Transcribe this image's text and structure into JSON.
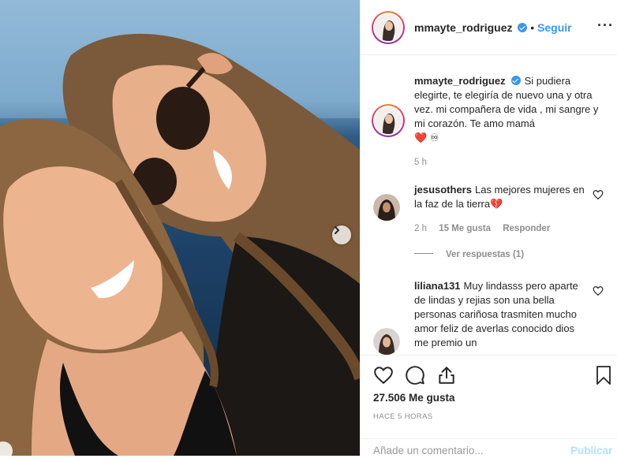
{
  "photo": {
    "description_icon": "next-arrow-icon"
  },
  "header": {
    "username": "mmayte_rodriguez",
    "follow_label": "Seguir",
    "more_icon": "more-options-icon"
  },
  "caption": {
    "username": "mmayte_rodriguez",
    "text": "Si pudiera elegirte, te elegiría de nuevo una y otra vez. mi compañera de vida , mi sangre y mi corazón. Te amo mamá",
    "emoji": "❤️ ♾",
    "time": "5 h"
  },
  "comments": [
    {
      "username": "jesusothers",
      "text": "Las mejores mujeres en la faz de la tierra",
      "emoji": "💔",
      "time": "2 h",
      "likes": "15 Me gusta",
      "reply_label": "Responder",
      "view_replies": "Ver respuestas (1)"
    },
    {
      "username": "liliana131",
      "text": "Muy lindasss pero aparte de lindas y rejias son una bella personas cariñosa trasmiten mucho amor feliz de averlas conocido dios me premio un"
    }
  ],
  "actions": {
    "likes": "27.506 Me gusta",
    "time": "HACE 5 HORAS",
    "comment_placeholder": "Añade un comentario...",
    "publish_label": "Publicar"
  },
  "colors": {
    "accent": "#3897f0",
    "muted": "#8e8e8e",
    "publish_disabled": "#b2dffc"
  }
}
